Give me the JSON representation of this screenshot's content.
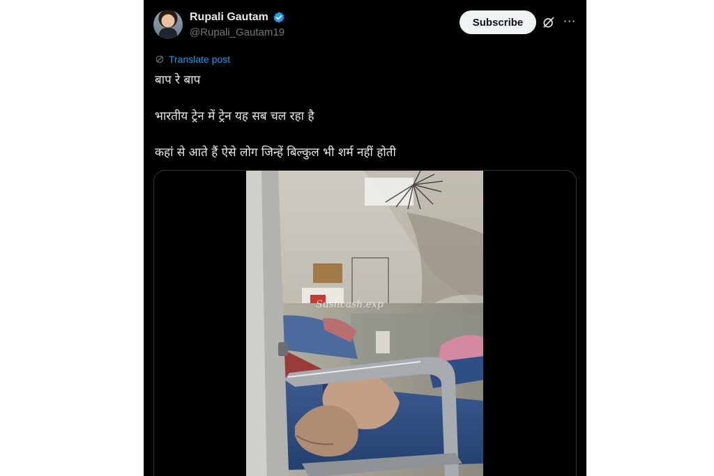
{
  "post": {
    "author_name": "Rupali Gautam",
    "author_handle": "@Rupali_Gautam19",
    "subscribe_label": "Subscribe",
    "more_label": "···",
    "translate_label": "Translate post",
    "lines": [
      "बाप रे बाप",
      "भारतीय ट्रेन में ट्रेन यह सब चल रहा है",
      "कहां से आते हैं ऐसे लोग जिन्हें बिल्कुल भी शर्म नहीं होती"
    ],
    "video_watermark": "Sushcash.exp"
  },
  "colors": {
    "background": "#000000",
    "accent": "#1d9bf0",
    "text": "#e7e9ea",
    "muted": "#71767b"
  },
  "icons": {
    "verified": "verified-badge-icon",
    "grok": "grok-icon",
    "translate": "translate-icon",
    "more": "more-icon"
  }
}
